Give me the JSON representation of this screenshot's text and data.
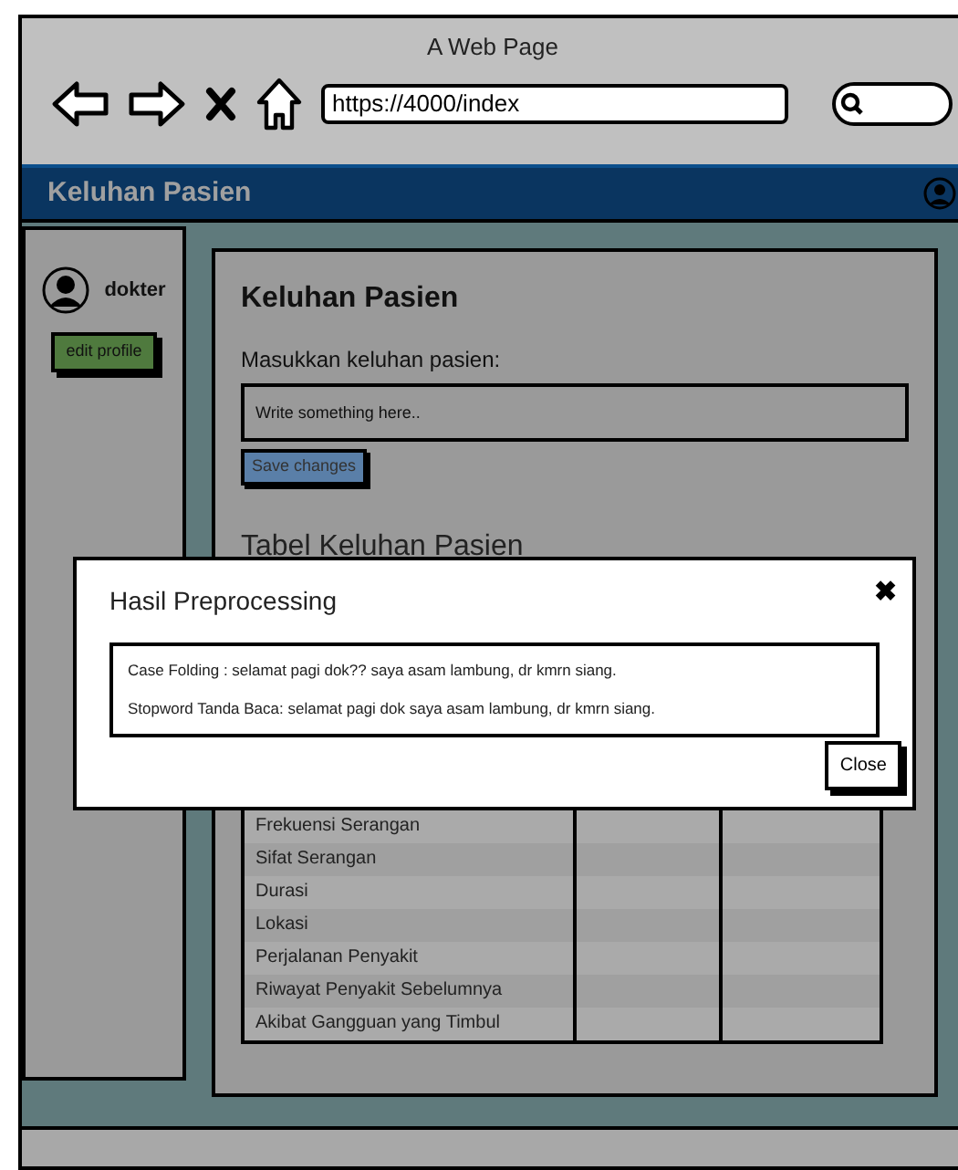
{
  "browser": {
    "title": "A Web Page",
    "url": "https://4000/index"
  },
  "navbar": {
    "title": "Keluhan Pasien"
  },
  "sidebar": {
    "username": "dokter",
    "edit_button": "edit profile"
  },
  "form": {
    "heading": "Keluhan Pasien",
    "label": "Masukkan keluhan pasien:",
    "placeholder": "Write something here..",
    "save_button": "Save changes"
  },
  "table": {
    "title": "Tabel Keluhan Pasien",
    "rows": [
      "Frekuensi Serangan",
      "Sifat Serangan",
      "Durasi",
      "Lokasi",
      "Perjalanan Penyakit",
      "Riwayat Penyakit Sebelumnya",
      "Akibat Gangguan yang Timbul"
    ]
  },
  "modal": {
    "title": "Hasil Preprocessing",
    "close_icon": "✖",
    "lines": [
      "Case Folding : selamat pagi dok?? saya asam lambung, dr kmrn siang.",
      "Stopword Tanda Baca: selamat pagi dok  saya asam lambung, dr kmrn siang."
    ],
    "close_button": "Close"
  }
}
